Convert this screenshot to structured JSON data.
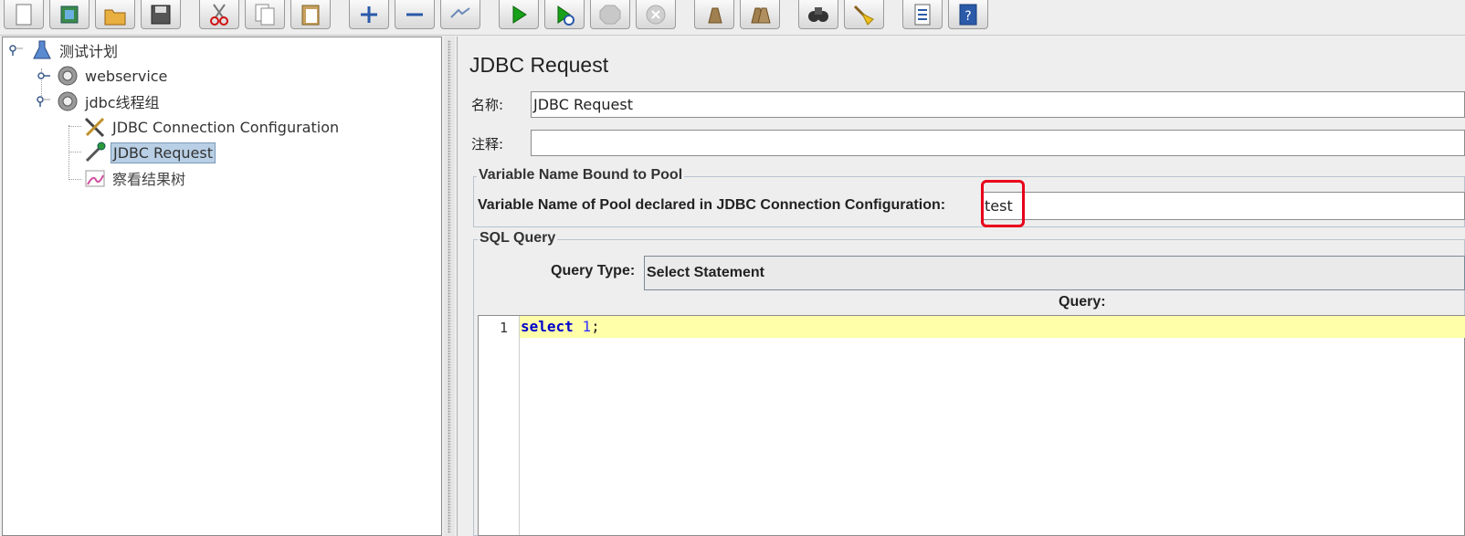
{
  "toolbar": {
    "buttons": [
      "new-icon",
      "templates-icon",
      "open-icon",
      "save-icon",
      "cut-icon",
      "copy-icon",
      "paste-icon",
      "expand-icon",
      "collapse-icon",
      "toggle-icon",
      "start-icon",
      "start-no-pause-icon",
      "stop-icon",
      "shutdown-icon",
      "clear-icon",
      "clear-all-icon",
      "search-icon",
      "reset-search-icon",
      "function-helper-icon",
      "help-icon"
    ]
  },
  "tree": {
    "items": [
      {
        "label": "测试计划",
        "icon": "test-plan-icon"
      },
      {
        "label": "webservice",
        "icon": "thread-group-icon"
      },
      {
        "label": "jdbc线程组",
        "icon": "thread-group-icon"
      },
      {
        "label": "JDBC Connection Configuration",
        "icon": "config-tools-icon"
      },
      {
        "label": "JDBC Request",
        "icon": "sampler-pipette-icon",
        "selected": true
      },
      {
        "label": "察看结果树",
        "icon": "listener-chart-icon"
      }
    ]
  },
  "panel": {
    "title": "JDBC Request",
    "name_label": "名称:",
    "name_value": "JDBC Request",
    "comment_label": "注释:",
    "comment_value": "",
    "pool_group_title": "Variable Name Bound to Pool",
    "pool_label": "Variable Name of Pool declared in JDBC Connection Configuration:",
    "pool_value": "test",
    "sql_group_title": "SQL Query",
    "query_type_label": "Query Type:",
    "query_type_value": "Select Statement",
    "query_label": "Query:",
    "editor": {
      "line_number": "1",
      "code_keyword": "select",
      "code_number": "1",
      "code_end": ";"
    }
  },
  "colors": {
    "highlight_box": "#e8001a",
    "current_line": "#ffffaa",
    "keyword": "#0000cc",
    "selection": "#b8cfe5"
  }
}
